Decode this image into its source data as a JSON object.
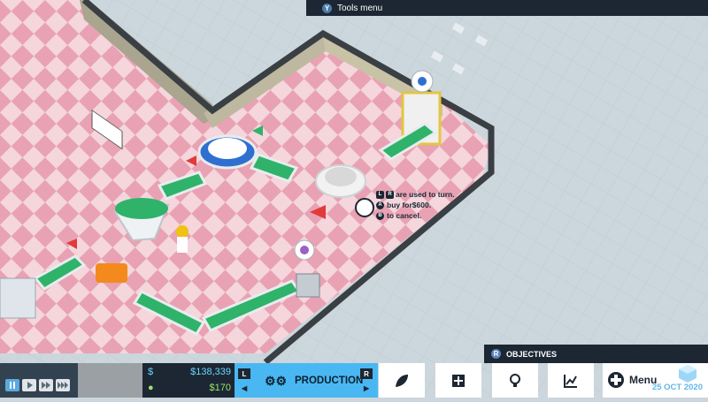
{
  "tools_menu": {
    "key": "Y",
    "label": "Tools menu"
  },
  "tooltip": {
    "line1_keys": [
      "L",
      "R"
    ],
    "line1": "are used to turn.",
    "line2_key": "A",
    "line2": "buy for$600.",
    "line3_key": "B",
    "line3": "to cancel."
  },
  "objectives": {
    "key": "R",
    "label": "OBJECTIVES"
  },
  "money": {
    "cash_symbol": "$",
    "cash": "$138,339",
    "income": "$170"
  },
  "production": {
    "left_key": "L",
    "right_key": "R",
    "label": "PRODUCTION"
  },
  "menu": {
    "label": "Menu"
  },
  "date": "25 OCT 2020",
  "icons": [
    "pause-icon",
    "play-icon",
    "fast-forward-icon",
    "fastest-icon",
    "gears-icon",
    "leaf-icon",
    "plus-icon",
    "lightbulb-icon",
    "chart-icon",
    "dpad-icon",
    "cube-logo-icon"
  ],
  "colors": {
    "floor_pink": "#e9a3b4",
    "floor_light": "#f6d8de",
    "wall": "#b9b39b",
    "belt": "#2fb36a",
    "panel_dark": "#1c2733",
    "accent_blue": "#49b8f2",
    "cash_blue": "#6ad6ff",
    "income_green": "#9be36b"
  }
}
